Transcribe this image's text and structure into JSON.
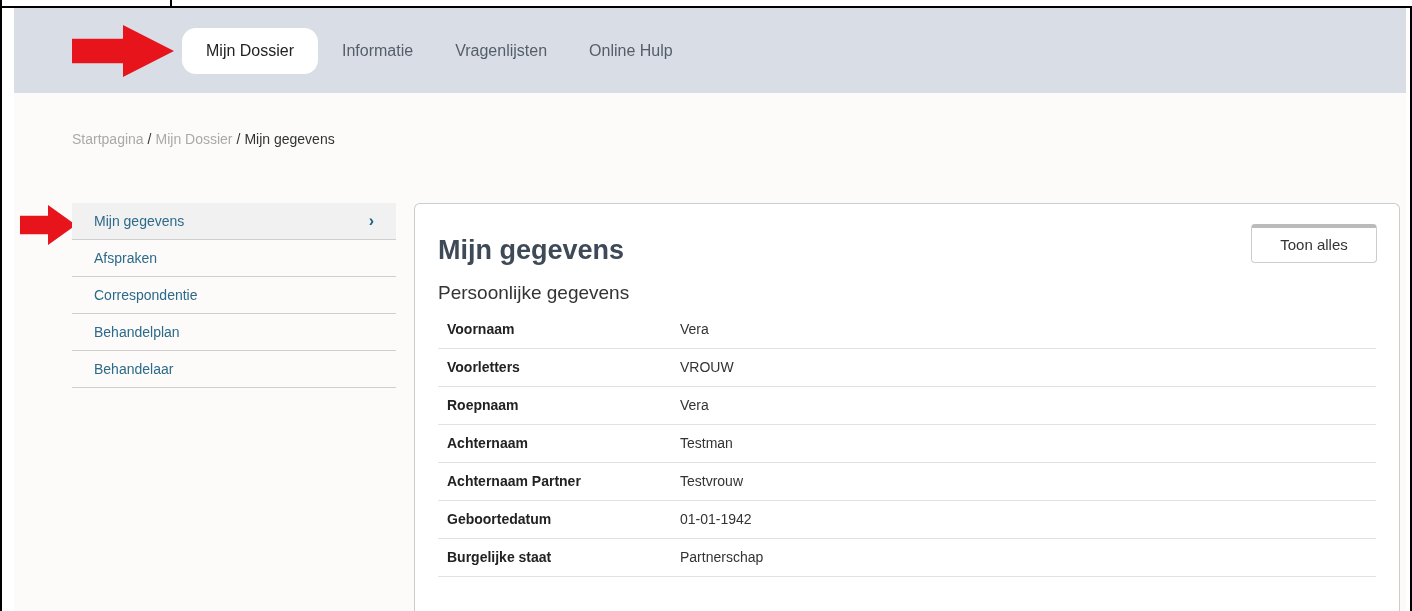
{
  "nav": {
    "tabs": [
      {
        "label": "Mijn Dossier",
        "selected": true
      },
      {
        "label": "Informatie",
        "selected": false
      },
      {
        "label": "Vragenlijsten",
        "selected": false
      },
      {
        "label": "Online Hulp",
        "selected": false
      }
    ]
  },
  "breadcrumb": {
    "links": [
      "Startpagina",
      "Mijn Dossier"
    ],
    "separator": "/",
    "current": "Mijn gegevens"
  },
  "sidebar": {
    "chevron": "›",
    "items": [
      {
        "label": "Mijn gegevens",
        "selected": true
      },
      {
        "label": "Afspraken",
        "selected": false
      },
      {
        "label": "Correspondentie",
        "selected": false
      },
      {
        "label": "Behandelplan",
        "selected": false
      },
      {
        "label": "Behandelaar",
        "selected": false
      }
    ]
  },
  "panel": {
    "title": "Mijn gegevens",
    "button": "Toon alles",
    "section": "Persoonlijke gegevens",
    "rows": [
      {
        "label": "Voornaam",
        "value": "Vera"
      },
      {
        "label": "Voorletters",
        "value": "VROUW"
      },
      {
        "label": "Roepnaam",
        "value": "Vera"
      },
      {
        "label": "Achternaam",
        "value": "Testman"
      },
      {
        "label": "Achternaam Partner",
        "value": "Testvrouw"
      },
      {
        "label": "Geboortedatum",
        "value": "01-01-1942"
      },
      {
        "label": "Burgelijke staat",
        "value": "Partnerschap"
      }
    ]
  }
}
